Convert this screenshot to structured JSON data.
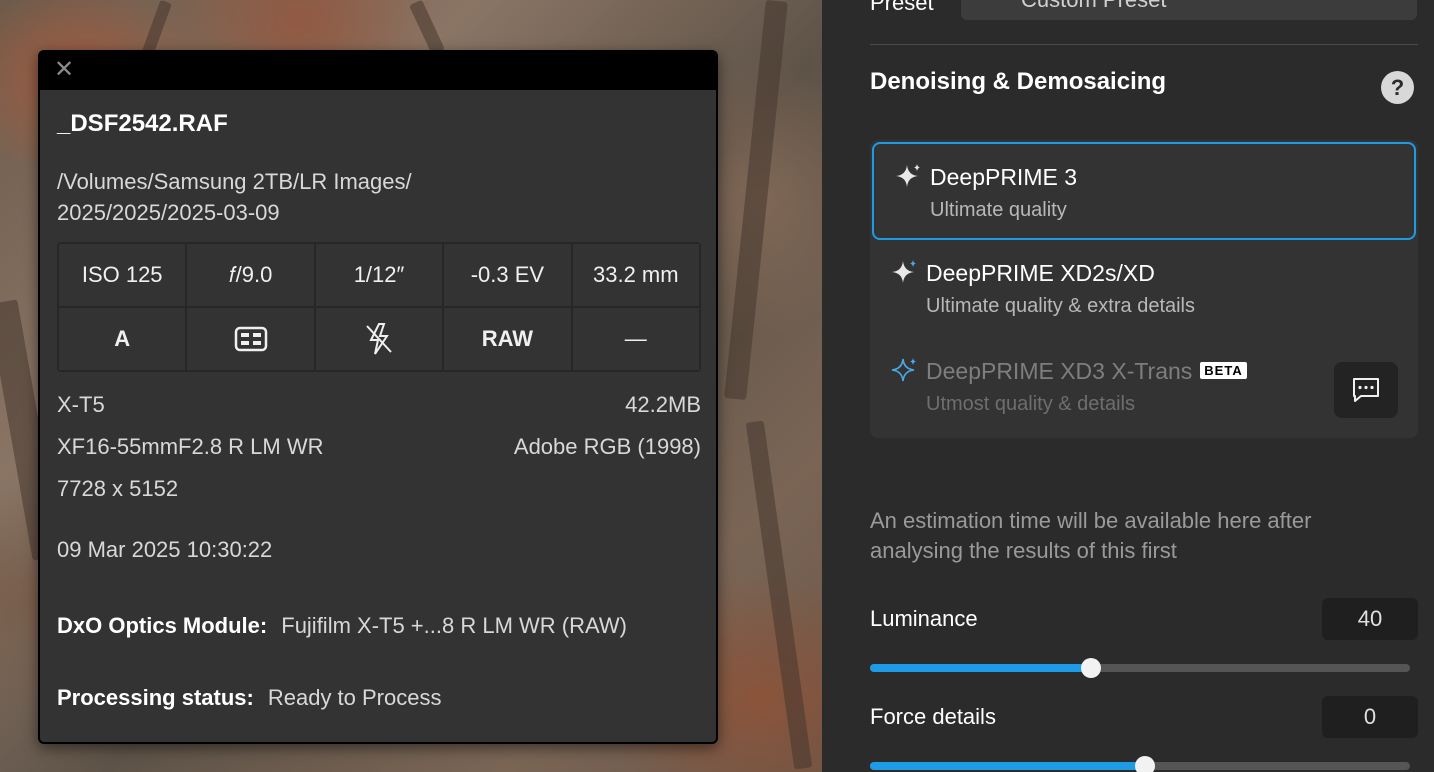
{
  "info": {
    "close_glyph": "✕",
    "filename": "_DSF2542.RAF",
    "path": "/Volumes/Samsung 2TB/LR Images/\n2025/2025/2025-03-09",
    "grid_row1": [
      "ISO 125",
      "𝑓/9.0",
      "1/12″",
      "-0.3 EV",
      "33.2 mm"
    ],
    "grid_row2_labels": {
      "mode": "A",
      "format": "RAW",
      "dash": "—"
    },
    "camera": "X-T5",
    "size": "42.2MB",
    "lens": "XF16-55mmF2.8 R LM WR",
    "colorspace": "Adobe RGB (1998)",
    "dimensions": "7728 x 5152",
    "datetime": "09 Mar 2025 10:30:22",
    "optics_label": "DxO Optics Module:",
    "optics_value": "Fujifilm X-T5 +...8 R LM WR (RAW)",
    "status_label": "Processing status:",
    "status_value": "Ready to Process"
  },
  "panel": {
    "preset_label": "Preset",
    "preset_value": "Custom Preset",
    "section_title": "Denoising & Demosaicing",
    "help": "?",
    "options": [
      {
        "name": "DeepPRIME 3",
        "sub": "Ultimate quality",
        "selected": true,
        "disabled": false
      },
      {
        "name": "DeepPRIME XD2s/XD",
        "sub": "Ultimate quality & extra details",
        "selected": false,
        "disabled": false
      },
      {
        "name": "DeepPRIME XD3 X-Trans",
        "sub": "Utmost quality & details",
        "selected": false,
        "disabled": true,
        "badge": "BETA"
      }
    ],
    "estimation": "An estimation time will be available here after analysing the results of this first",
    "luminance": {
      "label": "Luminance",
      "value": "40",
      "fraction": 0.41
    },
    "force_details": {
      "label": "Force details",
      "value": "0",
      "fraction": 0.51
    },
    "accent_color": "#1e9be6"
  }
}
